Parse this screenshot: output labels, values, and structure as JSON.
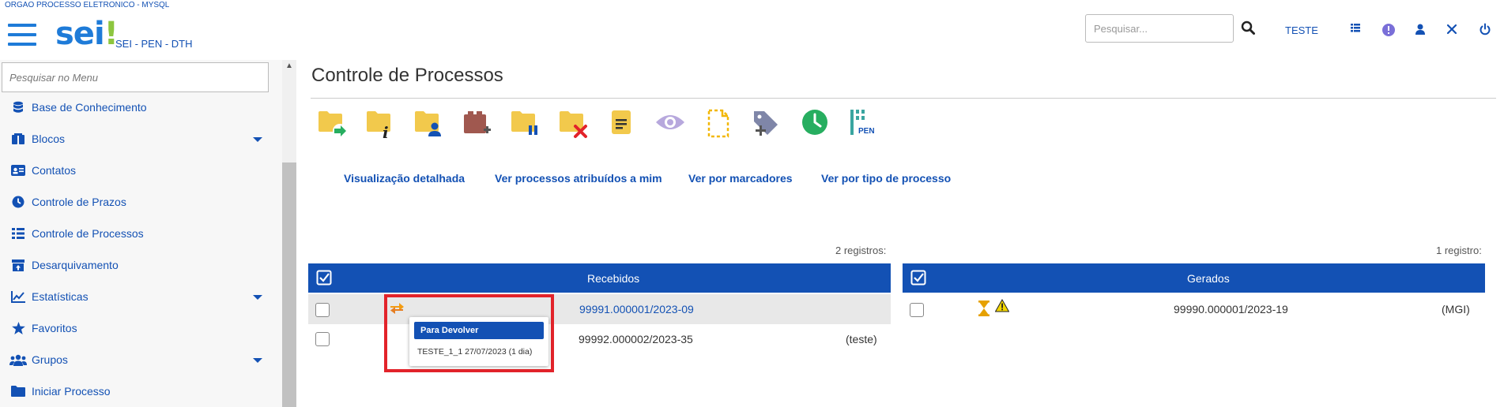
{
  "header": {
    "system_name": "ORGAO PROCESSO ELETRONICO - MYSQL",
    "logo_text": "sei",
    "logo_bang": "!",
    "org_label": "SEI - PEN - DTH",
    "search_placeholder": "Pesquisar...",
    "user_label": "TESTE",
    "icons": [
      "search-icon",
      "grid-icon",
      "info-icon",
      "user-icon",
      "tools-icon",
      "power-icon"
    ]
  },
  "sidebar": {
    "search_placeholder": "Pesquisar no Menu",
    "items": [
      {
        "label": "Base de Conhecimento",
        "icon": "database-icon",
        "expandable": false
      },
      {
        "label": "Blocos",
        "icon": "book-icon",
        "expandable": true
      },
      {
        "label": "Contatos",
        "icon": "id-card-icon",
        "expandable": false
      },
      {
        "label": "Controle de Prazos",
        "icon": "clock-icon",
        "expandable": false
      },
      {
        "label": "Controle de Processos",
        "icon": "list-icon",
        "expandable": false
      },
      {
        "label": "Desarquivamento",
        "icon": "archive-icon",
        "expandable": false
      },
      {
        "label": "Estatísticas",
        "icon": "chart-icon",
        "expandable": true
      },
      {
        "label": "Favoritos",
        "icon": "star-icon",
        "expandable": false
      },
      {
        "label": "Grupos",
        "icon": "users-icon",
        "expandable": true
      },
      {
        "label": "Iniciar Processo",
        "icon": "folder-icon",
        "expandable": false
      }
    ]
  },
  "main": {
    "title": "Controle de Processos",
    "toolbar_icons": [
      "send-process-icon",
      "process-info-icon",
      "assign-process-icon",
      "attach-process-icon",
      "suspend-process-icon",
      "conclude-process-icon",
      "annotation-icon",
      "view-icon",
      "new-document-icon",
      "add-marker-icon",
      "control-deadline-icon",
      "pen-icon"
    ],
    "toolbar_pen_label": "PEN",
    "links": [
      "Visualização detalhada",
      "Ver processos atribuídos a mim",
      "Ver por marcadores",
      "Ver por tipo de processo"
    ]
  },
  "received": {
    "count": "2 registros:",
    "header": "Recebidos",
    "rows": [
      {
        "process": "99991.000001/2023-09",
        "note": "",
        "is_link": true
      },
      {
        "process": "99992.000002/2023-35",
        "note": "(teste)",
        "is_link": false
      }
    ]
  },
  "generated": {
    "count": "1 registro:",
    "header": "Gerados",
    "rows": [
      {
        "process": "99990.000001/2023-19",
        "note": "(MGI)"
      }
    ]
  },
  "popup": {
    "title": "Para Devolver",
    "info": "TESTE_1_1 27/07/2023 (1 dia)"
  },
  "colors": {
    "primary": "#1351b4",
    "link": "#1351b4",
    "highlight_border": "#e2232a",
    "row_alt": "#e8e8e8",
    "folder_yellow": "#f2c94c",
    "logo_green": "#8dc63f"
  }
}
